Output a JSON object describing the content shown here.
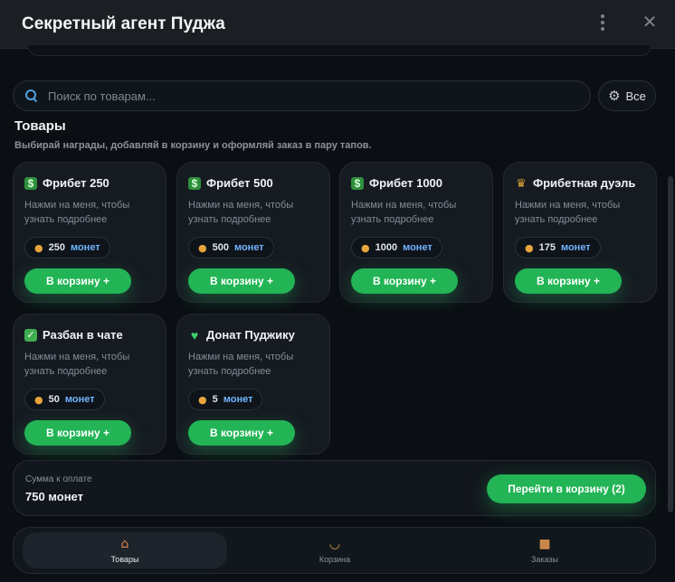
{
  "window": {
    "title": "Секретный агент Пуджа"
  },
  "search": {
    "placeholder": "Поиск по товарам..."
  },
  "filter": {
    "label": "Все"
  },
  "section": {
    "title": "Товары",
    "subtitle": "Выбирай награды, добавляй в корзину и оформляй заказ в пару тапов."
  },
  "products": [
    {
      "name": "Фрибет 250",
      "icon": "money-icon",
      "icon_glyph": "$",
      "icon_color": "#3fae4f",
      "desc": "Нажми на меня, чтобы узнать подробнее",
      "price": "250",
      "currency": "монет",
      "button": "В корзину +"
    },
    {
      "name": "Фрибет 500",
      "icon": "money-icon",
      "icon_glyph": "$",
      "icon_color": "#3fae4f",
      "desc": "Нажми на меня, чтобы узнать подробнее",
      "price": "500",
      "currency": "монет",
      "button": "В корзину +"
    },
    {
      "name": "Фрибет 1000",
      "icon": "money-icon",
      "icon_glyph": "$",
      "icon_color": "#3fae4f",
      "desc": "Нажми на меня, чтобы узнать подробнее",
      "price": "1000",
      "currency": "монет",
      "button": "В корзину +"
    },
    {
      "name": "Фрибетная дуэль",
      "icon": "trophy-icon",
      "icon_glyph": "♛",
      "icon_color": "#e0a532",
      "desc": "Нажми на меня, чтобы узнать подробнее",
      "price": "175",
      "currency": "монет",
      "button": "В корзину +"
    },
    {
      "name": "Разбан в чате",
      "icon": "check-box-icon",
      "icon_glyph": "✓",
      "icon_color": "#3fae4f",
      "desc": "Нажми на меня, чтобы узнать подробнее",
      "price": "50",
      "currency": "монет",
      "button": "В корзину +"
    },
    {
      "name": "Донат Пуджику",
      "icon": "green-heart-icon",
      "icon_glyph": "♥",
      "icon_color": "#3ecf6e",
      "desc": "Нажми на меня, чтобы узнать подробнее",
      "price": "5",
      "currency": "монет",
      "button": "В корзину +"
    }
  ],
  "summary": {
    "label": "Сумма к оплате",
    "total": "750 монет",
    "checkout": "Перейти в корзину (2)"
  },
  "nav": [
    {
      "label": "Товары",
      "icon": "house-icon",
      "active": true
    },
    {
      "label": "Корзина",
      "icon": "basket-icon",
      "active": false
    },
    {
      "label": "Заказы",
      "icon": "package-icon",
      "active": false
    }
  ],
  "colors": {
    "accent": "#22b455",
    "background": "#0b0f14",
    "card": "#161b22",
    "currency": "#6fb4ff"
  }
}
